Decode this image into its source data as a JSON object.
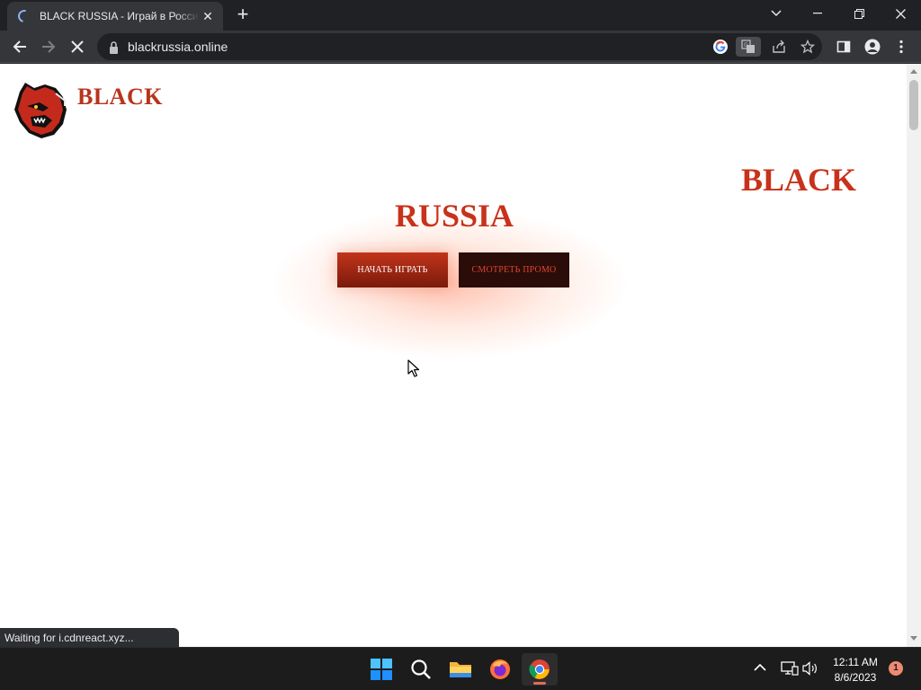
{
  "browser": {
    "tab_title": "BLACK RUSSIA - Играй в России",
    "tab_close": "✕",
    "new_tab": "+",
    "url": "blackrussia.online"
  },
  "page": {
    "logo_text": "BLACK",
    "hero_line1": "BLACK",
    "hero_line2": "RUSSIA",
    "play_button": "НАЧАТЬ ИГРАТЬ",
    "promo_button": "СМОТРЕТЬ ПРОМО"
  },
  "status": {
    "text": "Waiting for i.cdnreact.xyz..."
  },
  "taskbar": {
    "time": "12:11 AM",
    "date": "8/6/2023",
    "notifications": "1"
  },
  "colors": {
    "brand_red": "#c8321a",
    "promo_bg": "#2a0c08",
    "chrome_dark": "#202124",
    "chrome_toolbar": "#35363a"
  }
}
